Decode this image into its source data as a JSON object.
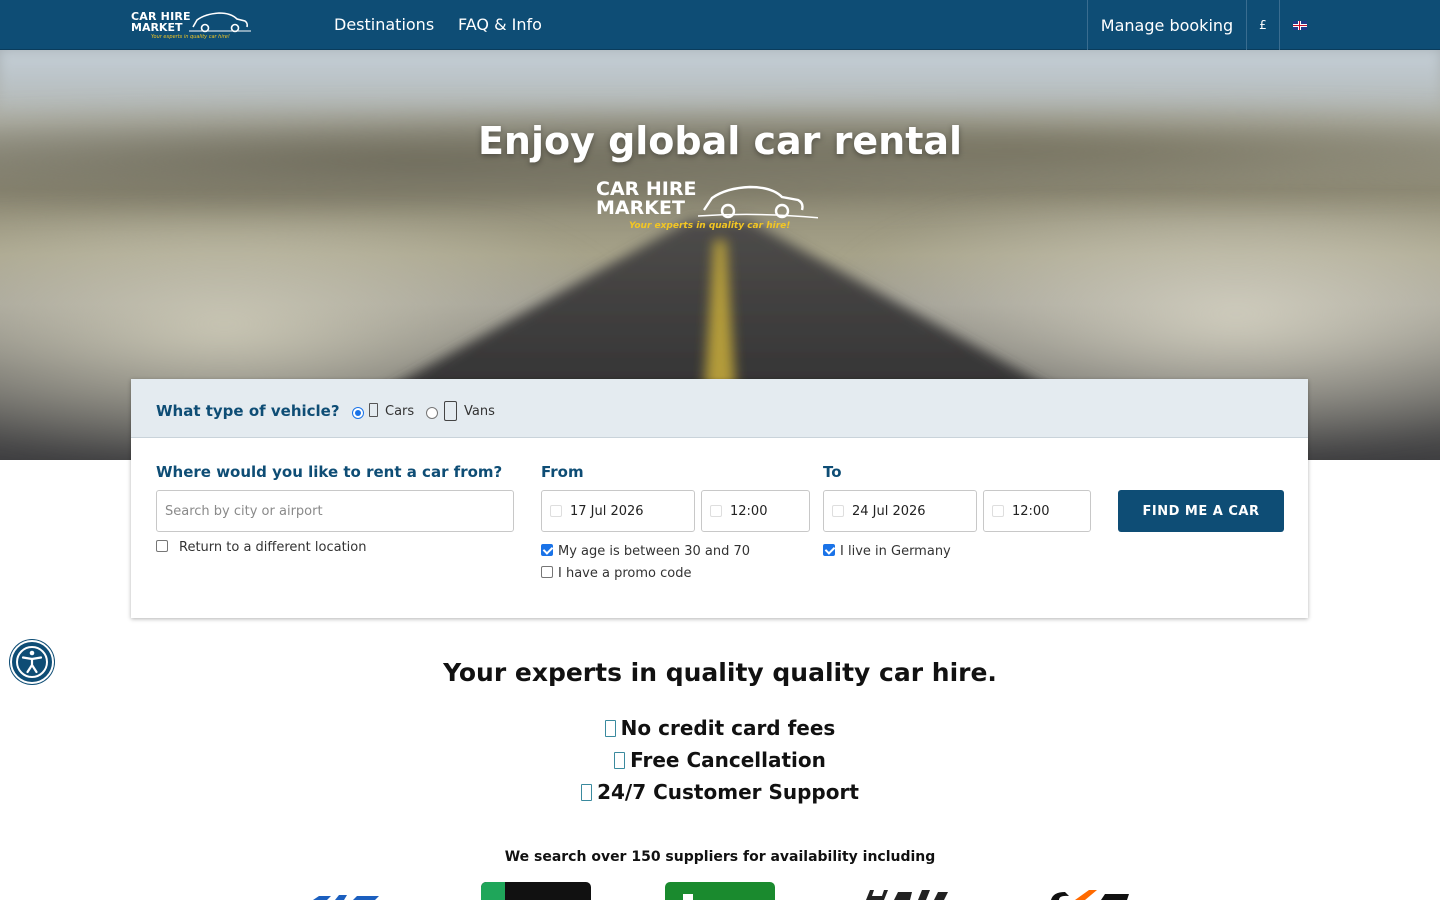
{
  "brand": {
    "line1": "CAR HIRE",
    "line2": "MARKET",
    "tagline": "Your experts in quality car hire!",
    "logo_icon": "car-outline-icon"
  },
  "nav": {
    "links": [
      {
        "label": "Destinations"
      },
      {
        "label": "FAQ & Info"
      }
    ],
    "manage_booking": "Manage booking",
    "currency": "£",
    "language_icon": "uk-flag-icon"
  },
  "hero": {
    "title": "Enjoy global car rental"
  },
  "search": {
    "vehicle_question": "What type of vehicle?",
    "vehicle_options": [
      {
        "label": "Cars",
        "icon": "car-icon",
        "selected": true
      },
      {
        "label": "Vans",
        "icon": "van-icon",
        "selected": false
      }
    ],
    "location_label": "Where would you like to rent a car from?",
    "location_placeholder": "Search by city or airport",
    "return_different": {
      "label": "Return to a different location",
      "checked": false
    },
    "from": {
      "label": "From",
      "date": "17 Jul 2026",
      "time": "12:00"
    },
    "to": {
      "label": "To",
      "date": "24 Jul 2026",
      "time": "12:00"
    },
    "age_check": {
      "label": "My age is between 30 and 70",
      "checked": true
    },
    "promo_check": {
      "label": "I have a promo code",
      "checked": false
    },
    "residence_check": {
      "label": "I live in Germany",
      "checked": true
    },
    "submit": "FIND ME A CAR"
  },
  "content": {
    "headline": "Your experts in quality quality car hire.",
    "features": [
      {
        "icon": "check-icon",
        "text": "No credit card fees"
      },
      {
        "icon": "check-icon",
        "text": "Free Cancellation"
      },
      {
        "icon": "check-icon",
        "text": "24/7 Customer Support"
      }
    ],
    "suppliers_text": "We search over 150 suppliers for availability including",
    "supplier_logos": [
      "supplier-logo-1",
      "supplier-logo-2",
      "supplier-logo-3",
      "hertz-logo",
      "sixt-logo"
    ]
  },
  "accessibility": {
    "icon": "accessibility-icon"
  },
  "colors": {
    "primary": "#0e4d75",
    "accent_yellow": "#f3c623",
    "panel": "#e4ebf0",
    "checkbox_blue": "#1a73e8"
  }
}
